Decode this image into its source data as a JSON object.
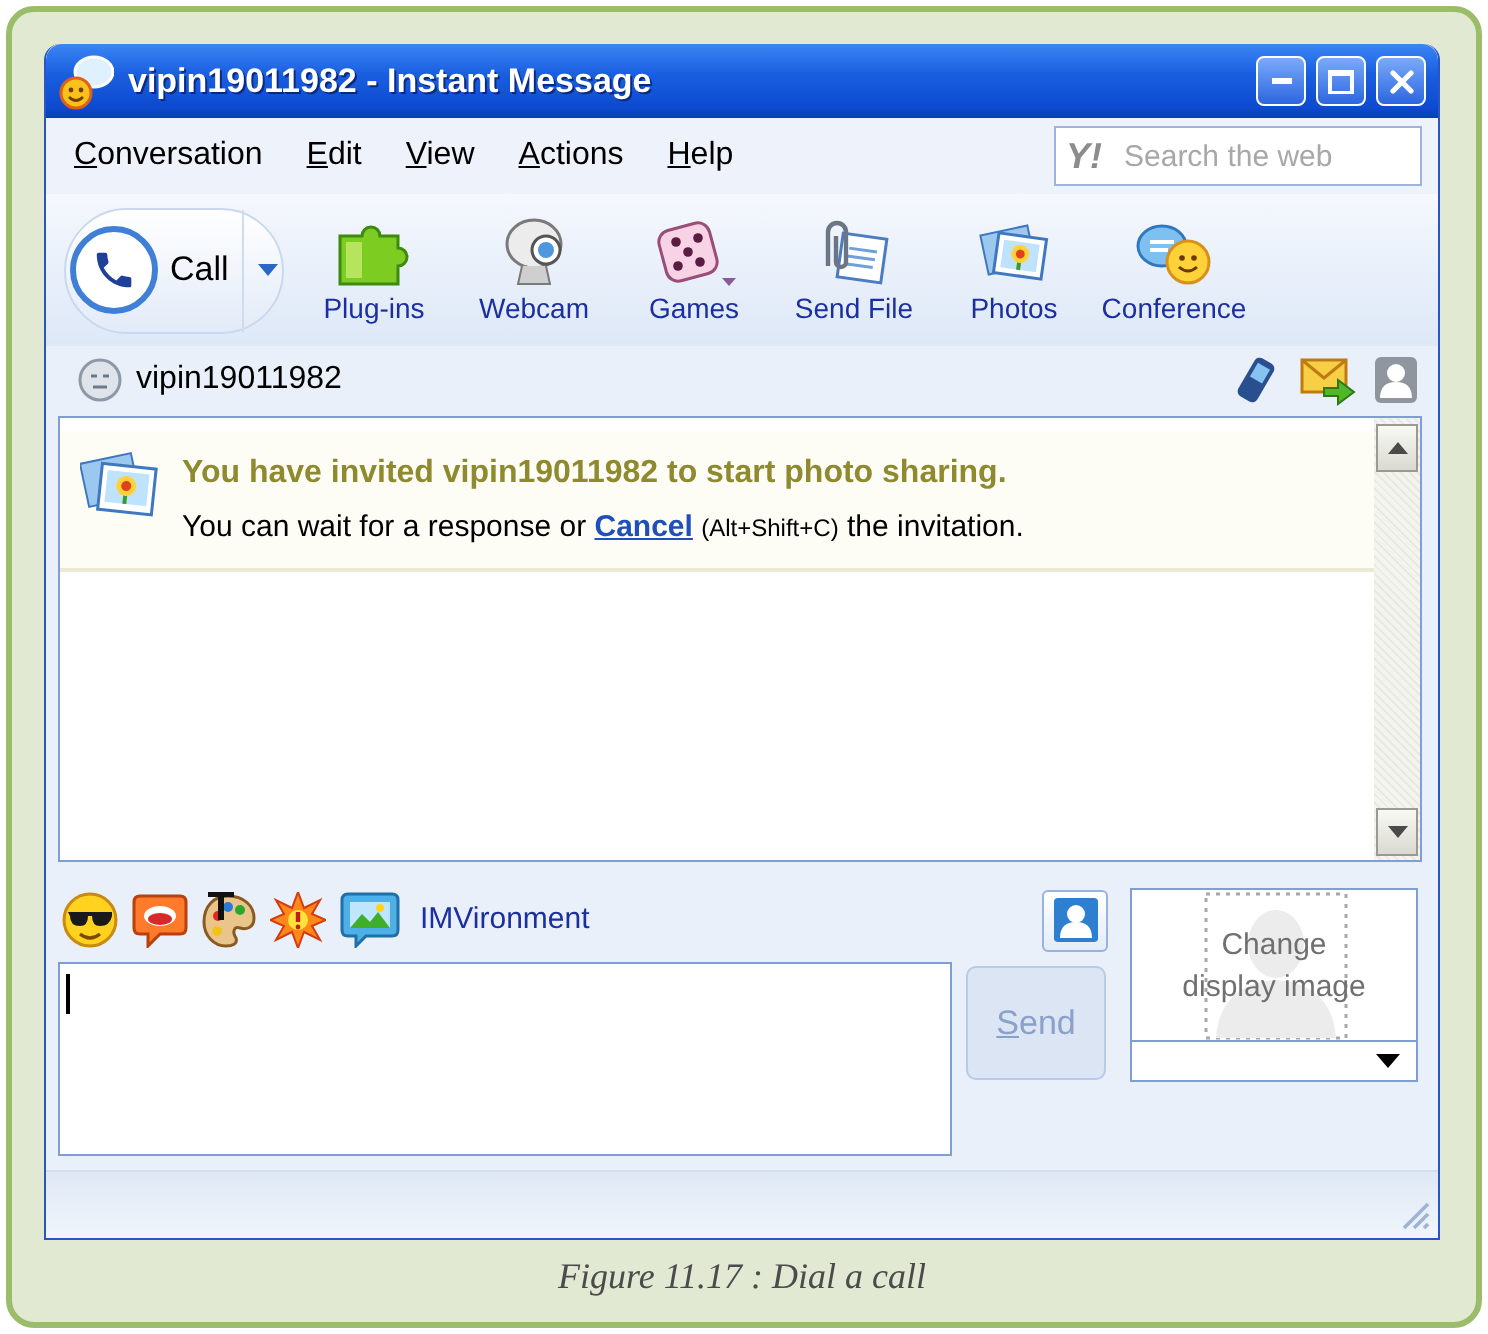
{
  "window": {
    "title": "vipin19011982 - Instant Message"
  },
  "menu": [
    {
      "label": "Conversation",
      "mnemonic": true
    },
    {
      "label": "Edit",
      "mnemonic": true
    },
    {
      "label": "View",
      "mnemonic": true
    },
    {
      "label": "Actions",
      "mnemonic": true
    },
    {
      "label": "Help",
      "mnemonic": true
    }
  ],
  "search": {
    "logo": "Y!",
    "placeholder": "Search the web"
  },
  "toolbar": {
    "call": {
      "label": "Call"
    },
    "items": [
      {
        "label": "Plug-ins",
        "kind": "plugins",
        "dropdown": false
      },
      {
        "label": "Webcam",
        "kind": "webcam",
        "dropdown": false
      },
      {
        "label": "Games",
        "kind": "games",
        "dropdown": true
      },
      {
        "label": "Send File",
        "kind": "file",
        "dropdown": false
      },
      {
        "label": "Photos",
        "kind": "photos",
        "dropdown": false
      },
      {
        "label": "Conference",
        "kind": "conference",
        "dropdown": false
      }
    ]
  },
  "contact": {
    "name": "vipin19011982"
  },
  "conversation": {
    "invitation": {
      "title": "You have invited vipin19011982 to start photo sharing.",
      "text_before": "You can wait for a response or",
      "link": "Cancel",
      "shortcut": "(Alt+Shift+C)",
      "text_after": "the invitation."
    }
  },
  "composer": {
    "imvironment": "IMVironment",
    "send": {
      "label": "Send",
      "mnemonic": true,
      "disabled": true
    }
  },
  "display_image": {
    "label": "Change display image"
  },
  "caption": "Figure 11.17 : Dial a call"
}
